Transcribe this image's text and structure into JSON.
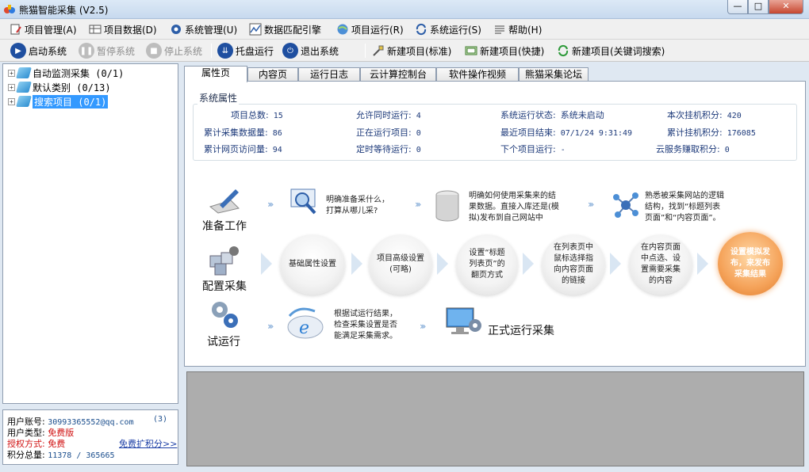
{
  "window": {
    "title": "熊猫智能采集 (V2.5)",
    "minimize": "—",
    "maximize": "□",
    "close": "✕"
  },
  "menu": [
    {
      "label": "项目管理(A)",
      "icon": "project-manage-icon"
    },
    {
      "label": "项目数据(D)",
      "icon": "project-data-icon"
    },
    {
      "label": "系统管理(U)",
      "icon": "system-manage-icon"
    },
    {
      "label": "数据匹配引擎",
      "icon": "data-match-icon"
    },
    {
      "label": "项目运行(R)",
      "icon": "project-run-icon"
    },
    {
      "label": "系统运行(S)",
      "icon": "system-run-icon"
    },
    {
      "label": "帮助(H)",
      "icon": "help-icon"
    }
  ],
  "toolbar": {
    "start": "启动系统",
    "pause": "暂停系统",
    "stop": "停止系统",
    "tray": "托盘运行",
    "exit": "退出系统",
    "new_standard": "新建项目(标准)",
    "new_quick": "新建项目(快捷)",
    "new_keyword": "新建项目(关键词搜索)"
  },
  "tree": [
    {
      "label": "自动监测采集 (0/1)",
      "selected": false
    },
    {
      "label": "默认类别 (0/13)",
      "selected": false
    },
    {
      "label": "搜索项目 (0/1)",
      "selected": true
    }
  ],
  "user": {
    "account_label": "用户账号:",
    "account_value": "30993365552@qq.com",
    "count": "(3)",
    "type_label": "用户类型:",
    "type_value": "免费版",
    "auth_label": "授权方式:",
    "auth_value": "免费",
    "expand_link": "免费扩积分>>",
    "points_label": "积分总量:",
    "points_value": "11378 / 365665"
  },
  "tabs": [
    "属性页",
    "内容页",
    "运行日志",
    "云计算控制台",
    "软件操作视频",
    "熊猫采集论坛"
  ],
  "props": {
    "group_title": "系统属性",
    "items": [
      {
        "k": "项目总数:",
        "v": "15"
      },
      {
        "k": "允许同时运行:",
        "v": "4"
      },
      {
        "k": "系统运行状态:",
        "v": "系统未启动"
      },
      {
        "k": "本次挂机积分:",
        "v": "420"
      },
      {
        "k": "累计采集数据量:",
        "v": "86"
      },
      {
        "k": "正在运行项目:",
        "v": "0"
      },
      {
        "k": "最近项目结束:",
        "v": "07/1/24 9:31:49"
      },
      {
        "k": "累计挂机积分:",
        "v": "176085"
      },
      {
        "k": "累计网页访问量:",
        "v": "94"
      },
      {
        "k": "定时等待运行:",
        "v": "0"
      },
      {
        "k": "下个项目运行:",
        "v": "-"
      },
      {
        "k": "云服务赚取积分:",
        "v": "0"
      }
    ]
  },
  "flow": {
    "prepare_label": "准备工作",
    "prepare_1": [
      "明确准备采什么，",
      "打算从哪儿采?"
    ],
    "prepare_2": [
      "明确如何使用采集来的结",
      "果数据。直接入库还是(模",
      "拟)发布到自己网站中"
    ],
    "prepare_3": [
      "熟悉被采集网站的逻辑",
      "结构，找到“标题列表",
      "页面”和“内容页面”。"
    ],
    "config_label": "配置采集",
    "steps": [
      [
        "基础属性设置"
      ],
      [
        "项目高级设置",
        "(可略)"
      ],
      [
        "设置“标题",
        "列表页”的",
        "翻页方式"
      ],
      [
        "在列表页中",
        "鼠标选择指",
        "向内容页面",
        "的链接"
      ],
      [
        "在内容页面",
        "中点选、设",
        "置需要采集",
        "的内容"
      ],
      [
        "设置模拟发",
        "布，来发布",
        "采集结果"
      ]
    ],
    "trial_label": "试运行",
    "trial_text": [
      "根据试运行结果，",
      "检查采集设置是否",
      "能满足采集需求。"
    ],
    "formal_label": "正式运行采集"
  },
  "colors": {
    "accent": "#3399ff",
    "link": "#1c3fa6",
    "value": "#1d3a7a",
    "highlight": "#f5a35a",
    "red": "#d01010"
  }
}
